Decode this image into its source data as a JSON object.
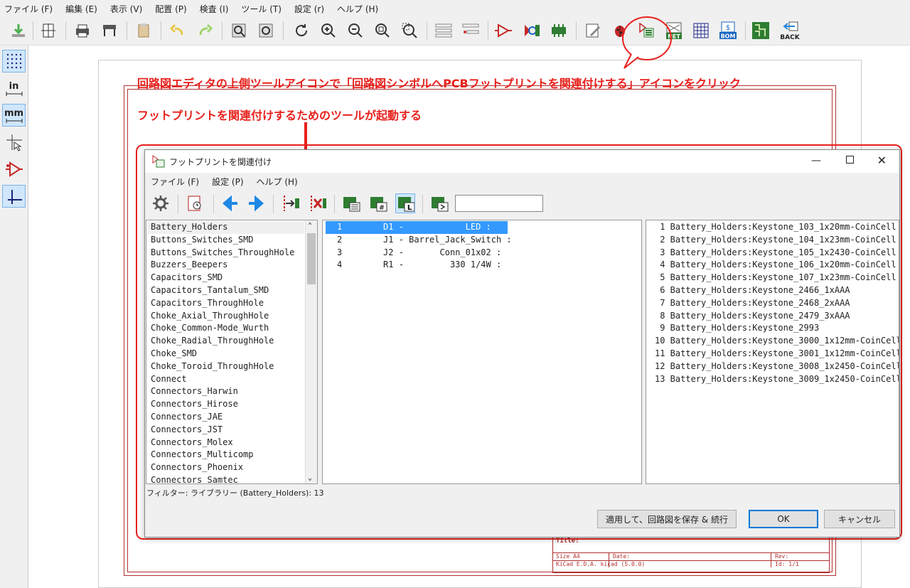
{
  "menubar": {
    "items": [
      "ファイル (F)",
      "編集 (E)",
      "表示 (V)",
      "配置 (P)",
      "検査 (I)",
      "ツール (T)",
      "設定 (r)",
      "ヘルプ (H)"
    ]
  },
  "toolbar": {
    "bom_label": "BOM",
    "net_label": "NET",
    "back_label": "BACK"
  },
  "left_toolbar": {
    "in_label": "in",
    "mm_label": "mm"
  },
  "annotations": {
    "line1": "回路図エディタの上側ツールアイコンで「回路図シンボルへPCBフットプリントを関連付けする」アイコンをクリック",
    "line2": "フットプリントを関連付けするためのツールが起動する"
  },
  "dialog": {
    "title": "フットプリントを関連付け",
    "menu": [
      "ファイル (F)",
      "設定 (P)",
      "ヘルプ (H)"
    ],
    "filter_input_value": "",
    "libraries": [
      "Battery_Holders",
      "Buttons_Switches_SMD",
      "Buttons_Switches_ThroughHole",
      "Buzzers_Beepers",
      "Capacitors_SMD",
      "Capacitors_Tantalum_SMD",
      "Capacitors_ThroughHole",
      "Choke_Axial_ThroughHole",
      "Choke_Common-Mode_Wurth",
      "Choke_Radial_ThroughHole",
      "Choke_SMD",
      "Choke_Toroid_ThroughHole",
      "Connect",
      "Connectors_Harwin",
      "Connectors_Hirose",
      "Connectors_JAE",
      "Connectors_JST",
      "Connectors_Molex",
      "Connectors_Multicomp",
      "Connectors_Phoenix",
      "Connectors_Samtec"
    ],
    "components": [
      "1        D1 -            LED :",
      "2        J1 - Barrel_Jack_Switch :",
      "3        J2 -       Conn_01x02 :",
      "4        R1 -         330 1/4W :"
    ],
    "footprints": [
      " 1 Battery_Holders:Keystone_103_1x20mm-CoinCell",
      " 2 Battery_Holders:Keystone_104_1x23mm-CoinCell",
      " 3 Battery_Holders:Keystone_105_1x2430-CoinCell",
      " 4 Battery_Holders:Keystone_106_1x20mm-CoinCell",
      " 5 Battery_Holders:Keystone_107_1x23mm-CoinCell",
      " 6 Battery_Holders:Keystone_2466_1xAAA",
      " 7 Battery_Holders:Keystone_2468_2xAAA",
      " 8 Battery_Holders:Keystone_2479_3xAAA",
      " 9 Battery_Holders:Keystone_2993",
      "10 Battery_Holders:Keystone_3000_1x12mm-CoinCell",
      "11 Battery_Holders:Keystone_3001_1x12mm-CoinCell",
      "12 Battery_Holders:Keystone_3008_1x2450-CoinCell",
      "13 Battery_Holders:Keystone_3009_1x2450-CoinCell"
    ],
    "status": "フィルター: ライブラリー (Battery_Holders): 13",
    "buttons": {
      "apply": "適用して、回路図を保存 & 続行",
      "ok": "OK",
      "cancel": "キャンセル"
    }
  },
  "titleblock": {
    "title": "Title:",
    "size": "Size  A4",
    "date": "Date:",
    "rev": "Rev:",
    "kicad": "KiCad E.D.A.  kicad (5.0.0)",
    "id": "Id: 1/1"
  },
  "colors": {
    "annotation": "#e8201c",
    "selection": "#3399ff",
    "frame": "#b03030"
  }
}
